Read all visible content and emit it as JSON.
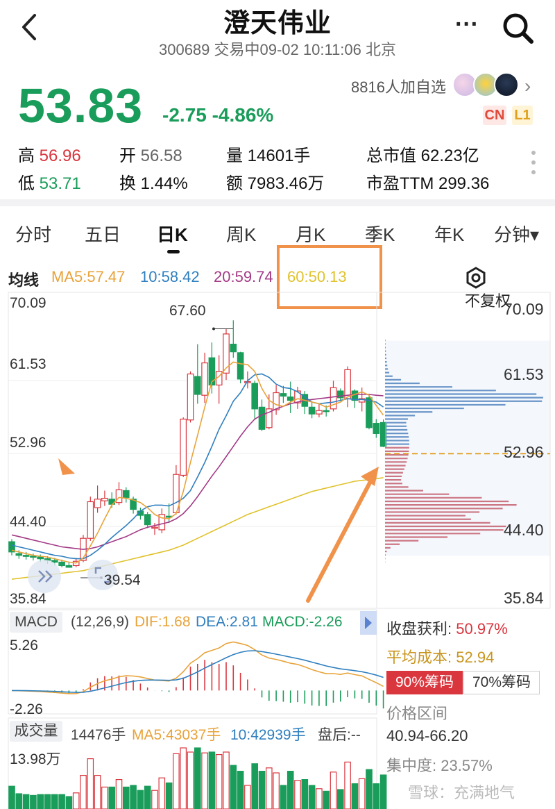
{
  "header": {
    "title": "澄天伟业",
    "subtitle": "300689 交易中09-02 10:11:06 北京",
    "back_icon": "chevron-left-icon",
    "more_icon": "more-dots-icon",
    "search_icon": "search-icon"
  },
  "quote": {
    "price": "53.83",
    "change": "-2.75 -4.86%",
    "followers": "8816人加自选",
    "badge_cn": "CN",
    "badge_l1": "L1"
  },
  "stats": {
    "high_label": "高",
    "high_value": "56.96",
    "open_label": "开",
    "open_value": "56.58",
    "volume_label": "量",
    "volume_value": "14601手",
    "market_cap_label": "总市值",
    "market_cap_value": "62.23亿",
    "low_label": "低",
    "low_value": "53.71",
    "turnover_label": "换",
    "turnover_value": "1.44%",
    "amount_label": "额",
    "amount_value": "7983.46万",
    "pe_label": "市盈TTM",
    "pe_value": "299.36"
  },
  "tabs": [
    "分时",
    "五日",
    "日K",
    "周K",
    "月K",
    "季K",
    "年K",
    "分钟▾"
  ],
  "ma": {
    "label": "均线",
    "ma5": "MA5:57.47",
    "ma10": "10:58.42",
    "ma20": "20:59.74",
    "ma60": "60:50.13",
    "fuquan": "不复权"
  },
  "price_axis": {
    "left": [
      "70.09",
      "61.53",
      "52.96",
      "44.40",
      "35.84"
    ],
    "right": [
      "70.09",
      "61.53",
      "52.96",
      "44.40",
      "35.84"
    ],
    "max_marker": "67.60",
    "min_marker": "39.54"
  },
  "macd": {
    "tag": "MACD",
    "params": "(12,26,9)",
    "dif": "DIF:1.68",
    "dea": "DEA:2.81",
    "macd": "MACD:-2.26",
    "top": "5.26",
    "bottom": "-2.26"
  },
  "volume": {
    "tag": "成交量",
    "value": "14476手",
    "ma5": "MA5:43037手",
    "ma10": "10:42939手",
    "after": "盘后:--",
    "top": "13.98万"
  },
  "chips": {
    "profit_label": "收盘获利:",
    "profit_value": "50.97%",
    "avg_cost_label": "平均成本:",
    "avg_cost_value": "52.94",
    "btn_90": "90%筹码",
    "btn_70": "70%筹码",
    "range_label": "价格区间",
    "range_value": "40.94-66.20",
    "concentration": "集中度: 23.57%"
  },
  "watermark": "雪球：充满地气",
  "colors": {
    "up": "#d9363e",
    "down": "#1a9c5a",
    "ma5": "#e8a33a",
    "ma10": "#2f7fbf",
    "ma20": "#a33a86",
    "ma60": "#e0c22c",
    "annotation": "#f0924a"
  },
  "chart_data": {
    "type": "candlestick",
    "candles": [
      {
        "o": 42.6,
        "c": 41.4,
        "h": 42.9,
        "l": 41.0
      },
      {
        "o": 41.2,
        "c": 41.0,
        "h": 41.6,
        "l": 40.6
      },
      {
        "o": 41.0,
        "c": 40.9,
        "h": 41.4,
        "l": 40.5
      },
      {
        "o": 40.9,
        "c": 40.8,
        "h": 41.2,
        "l": 40.4
      },
      {
        "o": 40.8,
        "c": 40.6,
        "h": 41.1,
        "l": 40.2
      },
      {
        "o": 40.6,
        "c": 40.4,
        "h": 40.9,
        "l": 40.0
      },
      {
        "o": 40.4,
        "c": 40.2,
        "h": 40.7,
        "l": 39.8
      },
      {
        "o": 40.2,
        "c": 39.8,
        "h": 40.5,
        "l": 39.6
      },
      {
        "o": 39.8,
        "c": 39.6,
        "h": 40.2,
        "l": 39.54
      },
      {
        "o": 39.8,
        "c": 40.3,
        "h": 40.7,
        "l": 39.6
      },
      {
        "o": 40.4,
        "c": 43.0,
        "h": 43.4,
        "l": 40.2
      },
      {
        "o": 43.0,
        "c": 47.3,
        "h": 47.9,
        "l": 42.7
      },
      {
        "o": 46.6,
        "c": 47.6,
        "h": 49.2,
        "l": 46.0
      },
      {
        "o": 47.4,
        "c": 47.7,
        "h": 48.6,
        "l": 46.8
      },
      {
        "o": 47.6,
        "c": 47.0,
        "h": 48.4,
        "l": 46.6
      },
      {
        "o": 47.2,
        "c": 48.7,
        "h": 49.6,
        "l": 46.9
      },
      {
        "o": 48.6,
        "c": 47.8,
        "h": 49.0,
        "l": 47.2
      },
      {
        "o": 47.6,
        "c": 46.4,
        "h": 47.9,
        "l": 45.9
      },
      {
        "o": 46.2,
        "c": 45.7,
        "h": 46.6,
        "l": 45.2
      },
      {
        "o": 45.8,
        "c": 44.6,
        "h": 46.1,
        "l": 44.2
      },
      {
        "o": 44.2,
        "c": 44.3,
        "h": 44.8,
        "l": 43.4
      },
      {
        "o": 44.0,
        "c": 45.8,
        "h": 46.5,
        "l": 43.6
      },
      {
        "o": 45.6,
        "c": 45.5,
        "h": 47.1,
        "l": 44.8
      },
      {
        "o": 46.0,
        "c": 50.5,
        "h": 51.6,
        "l": 45.8
      },
      {
        "o": 50.4,
        "c": 57.0,
        "h": 57.2,
        "l": 50.2
      },
      {
        "o": 56.9,
        "c": 62.3,
        "h": 62.6,
        "l": 56.6
      },
      {
        "o": 62.0,
        "c": 59.9,
        "h": 65.8,
        "l": 58.8
      },
      {
        "o": 59.8,
        "c": 63.6,
        "h": 64.8,
        "l": 58.9
      },
      {
        "o": 64.2,
        "c": 61.0,
        "h": 66.0,
        "l": 60.0
      },
      {
        "o": 61.0,
        "c": 62.6,
        "h": 64.5,
        "l": 58.8
      },
      {
        "o": 62.4,
        "c": 67.0,
        "h": 67.6,
        "l": 61.6
      },
      {
        "o": 65.8,
        "c": 64.9,
        "h": 68.6,
        "l": 64.2
      },
      {
        "o": 64.8,
        "c": 61.7,
        "h": 64.9,
        "l": 61.2
      },
      {
        "o": 61.4,
        "c": 61.4,
        "h": 62.6,
        "l": 60.6
      },
      {
        "o": 61.2,
        "c": 58.2,
        "h": 61.5,
        "l": 56.9
      },
      {
        "o": 58.4,
        "c": 55.8,
        "h": 59.3,
        "l": 55.6
      },
      {
        "o": 56.0,
        "c": 58.2,
        "h": 59.9,
        "l": 55.8
      },
      {
        "o": 58.1,
        "c": 60.1,
        "h": 61.0,
        "l": 57.5
      },
      {
        "o": 60.0,
        "c": 59.7,
        "h": 60.9,
        "l": 58.9
      },
      {
        "o": 59.6,
        "c": 59.2,
        "h": 61.4,
        "l": 57.7
      },
      {
        "o": 58.9,
        "c": 60.3,
        "h": 60.8,
        "l": 58.2
      },
      {
        "o": 59.9,
        "c": 58.5,
        "h": 60.3,
        "l": 57.6
      },
      {
        "o": 58.4,
        "c": 57.6,
        "h": 59.1,
        "l": 57.1
      },
      {
        "o": 57.6,
        "c": 58.0,
        "h": 58.8,
        "l": 57.2
      },
      {
        "o": 58.0,
        "c": 57.9,
        "h": 58.6,
        "l": 57.3
      },
      {
        "o": 58.2,
        "c": 60.7,
        "h": 61.5,
        "l": 57.9
      },
      {
        "o": 60.3,
        "c": 59.5,
        "h": 60.6,
        "l": 59.1
      },
      {
        "o": 59.4,
        "c": 62.8,
        "h": 63.2,
        "l": 58.4
      },
      {
        "o": 60.3,
        "c": 59.2,
        "h": 60.5,
        "l": 58.3
      },
      {
        "o": 59.0,
        "c": 59.4,
        "h": 60.7,
        "l": 57.9
      },
      {
        "o": 59.5,
        "c": 56.0,
        "h": 59.7,
        "l": 55.8
      },
      {
        "o": 56.5,
        "c": 55.3,
        "h": 57.0,
        "l": 54.8
      },
      {
        "o": 56.6,
        "c": 53.8,
        "h": 56.96,
        "l": 53.71
      }
    ],
    "ma5": [
      41.6,
      41.4,
      41.2,
      41.0,
      40.9,
      40.8,
      40.6,
      40.4,
      40.2,
      40.1,
      40.7,
      42.1,
      43.6,
      45.3,
      46.9,
      47.8,
      47.7,
      47.5,
      47.2,
      46.6,
      45.8,
      45.4,
      45.3,
      45.9,
      48.5,
      51.9,
      55.1,
      58.4,
      61.4,
      62.0,
      63.0,
      63.7,
      63.5,
      63.4,
      62.6,
      60.6,
      59.2,
      58.7,
      58.5,
      59.0,
      59.4,
      59.2,
      59.0,
      58.8,
      58.4,
      58.7,
      59.0,
      59.6,
      59.9,
      60.2,
      59.8,
      58.6,
      57.47
    ],
    "ma10": [
      42.2,
      42.0,
      41.8,
      41.6,
      41.4,
      41.2,
      41.0,
      40.9,
      40.7,
      40.6,
      40.6,
      41.0,
      41.6,
      42.3,
      43.1,
      43.8,
      44.5,
      45.3,
      46.2,
      46.7,
      46.9,
      46.9,
      46.8,
      47.2,
      47.7,
      48.6,
      50.2,
      51.9,
      53.8,
      55.8,
      57.4,
      59.1,
      60.1,
      61.5,
      62.2,
      62.3,
      61.9,
      61.1,
      60.7,
      60.6,
      60.2,
      59.6,
      59.0,
      58.8,
      58.9,
      59.0,
      59.2,
      59.4,
      59.3,
      59.3,
      59.2,
      59.0,
      58.42
    ],
    "ma20": [
      43.4,
      43.2,
      43.0,
      42.8,
      42.6,
      42.4,
      42.2,
      42.0,
      41.9,
      41.8,
      41.7,
      41.8,
      42.0,
      42.3,
      42.6,
      42.9,
      43.2,
      43.6,
      44.0,
      44.3,
      44.5,
      44.7,
      44.9,
      45.3,
      45.9,
      46.8,
      47.9,
      49.1,
      50.3,
      51.4,
      52.6,
      53.8,
      55.0,
      56.1,
      57.0,
      57.5,
      57.8,
      58.2,
      58.5,
      58.8,
      59.0,
      59.2,
      59.3,
      59.4,
      59.5,
      59.6,
      59.7,
      59.8,
      59.9,
      59.9,
      59.9,
      59.8,
      59.74
    ],
    "ma60": [
      38.2,
      38.3,
      38.4,
      38.5,
      38.6,
      38.7,
      38.8,
      38.9,
      39.0,
      39.1,
      39.2,
      39.4,
      39.6,
      39.8,
      40.0,
      40.2,
      40.4,
      40.6,
      40.8,
      41.0,
      41.2,
      41.4,
      41.6,
      41.9,
      42.2,
      42.6,
      43.0,
      43.4,
      43.8,
      44.2,
      44.6,
      45.0,
      45.4,
      45.8,
      46.1,
      46.4,
      46.7,
      47.0,
      47.3,
      47.6,
      47.9,
      48.2,
      48.5,
      48.7,
      48.9,
      49.1,
      49.3,
      49.5,
      49.7,
      49.8,
      49.9,
      50.0,
      50.13
    ],
    "price_range": [
      35.84,
      70.09
    ],
    "chip_distribution": {
      "price_range": [
        40.94,
        66.2
      ],
      "avg_cost": 52.94,
      "peaks": [
        {
          "price": 59.5,
          "weight": 1.0
        },
        {
          "price": 47.0,
          "weight": 0.78
        },
        {
          "price": 44.2,
          "weight": 0.75
        }
      ]
    },
    "macd_range": [
      -2.26,
      5.26
    ],
    "volume_max": "13.98万"
  }
}
